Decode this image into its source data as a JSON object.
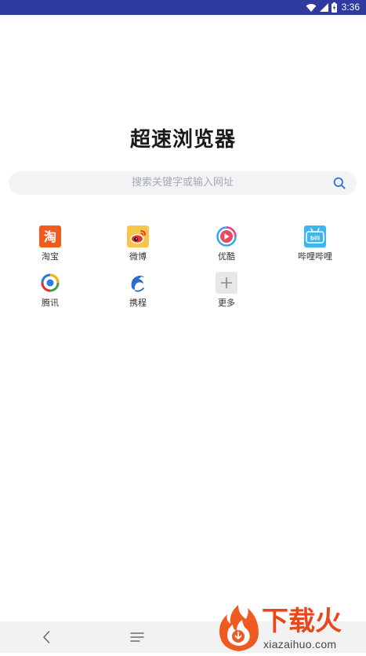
{
  "status_bar": {
    "time": "3:36",
    "icons": [
      "wifi-icon",
      "cell-signal-icon",
      "battery-icon"
    ]
  },
  "title": "超速浏览器",
  "search": {
    "placeholder": "搜索关键字或输入网址",
    "icon": "search-icon"
  },
  "shortcuts": [
    {
      "label": "淘宝",
      "icon": "taobao-icon",
      "color": "#f25a1b"
    },
    {
      "label": "微博",
      "icon": "weibo-icon",
      "color": "#f6c64a"
    },
    {
      "label": "优酷",
      "icon": "youku-icon",
      "color": "#2ea8f3"
    },
    {
      "label": "哔哩哔哩",
      "icon": "bilibili-icon",
      "color": "#3bb6ee"
    },
    {
      "label": "腾讯",
      "icon": "tencent-icon",
      "color": "#3aa14a"
    },
    {
      "label": "携程",
      "icon": "ctrip-icon",
      "color": "#2a6bd3"
    },
    {
      "label": "更多",
      "icon": "plus-icon",
      "color": "#e7e7e7"
    }
  ],
  "bottom_nav": {
    "icons": [
      "back-icon",
      "menu-icon"
    ]
  },
  "watermark": {
    "title": "下载火",
    "subtitle": "xiazaihuo.com",
    "color": "#e8491a"
  },
  "accent": "#2e3a9e"
}
